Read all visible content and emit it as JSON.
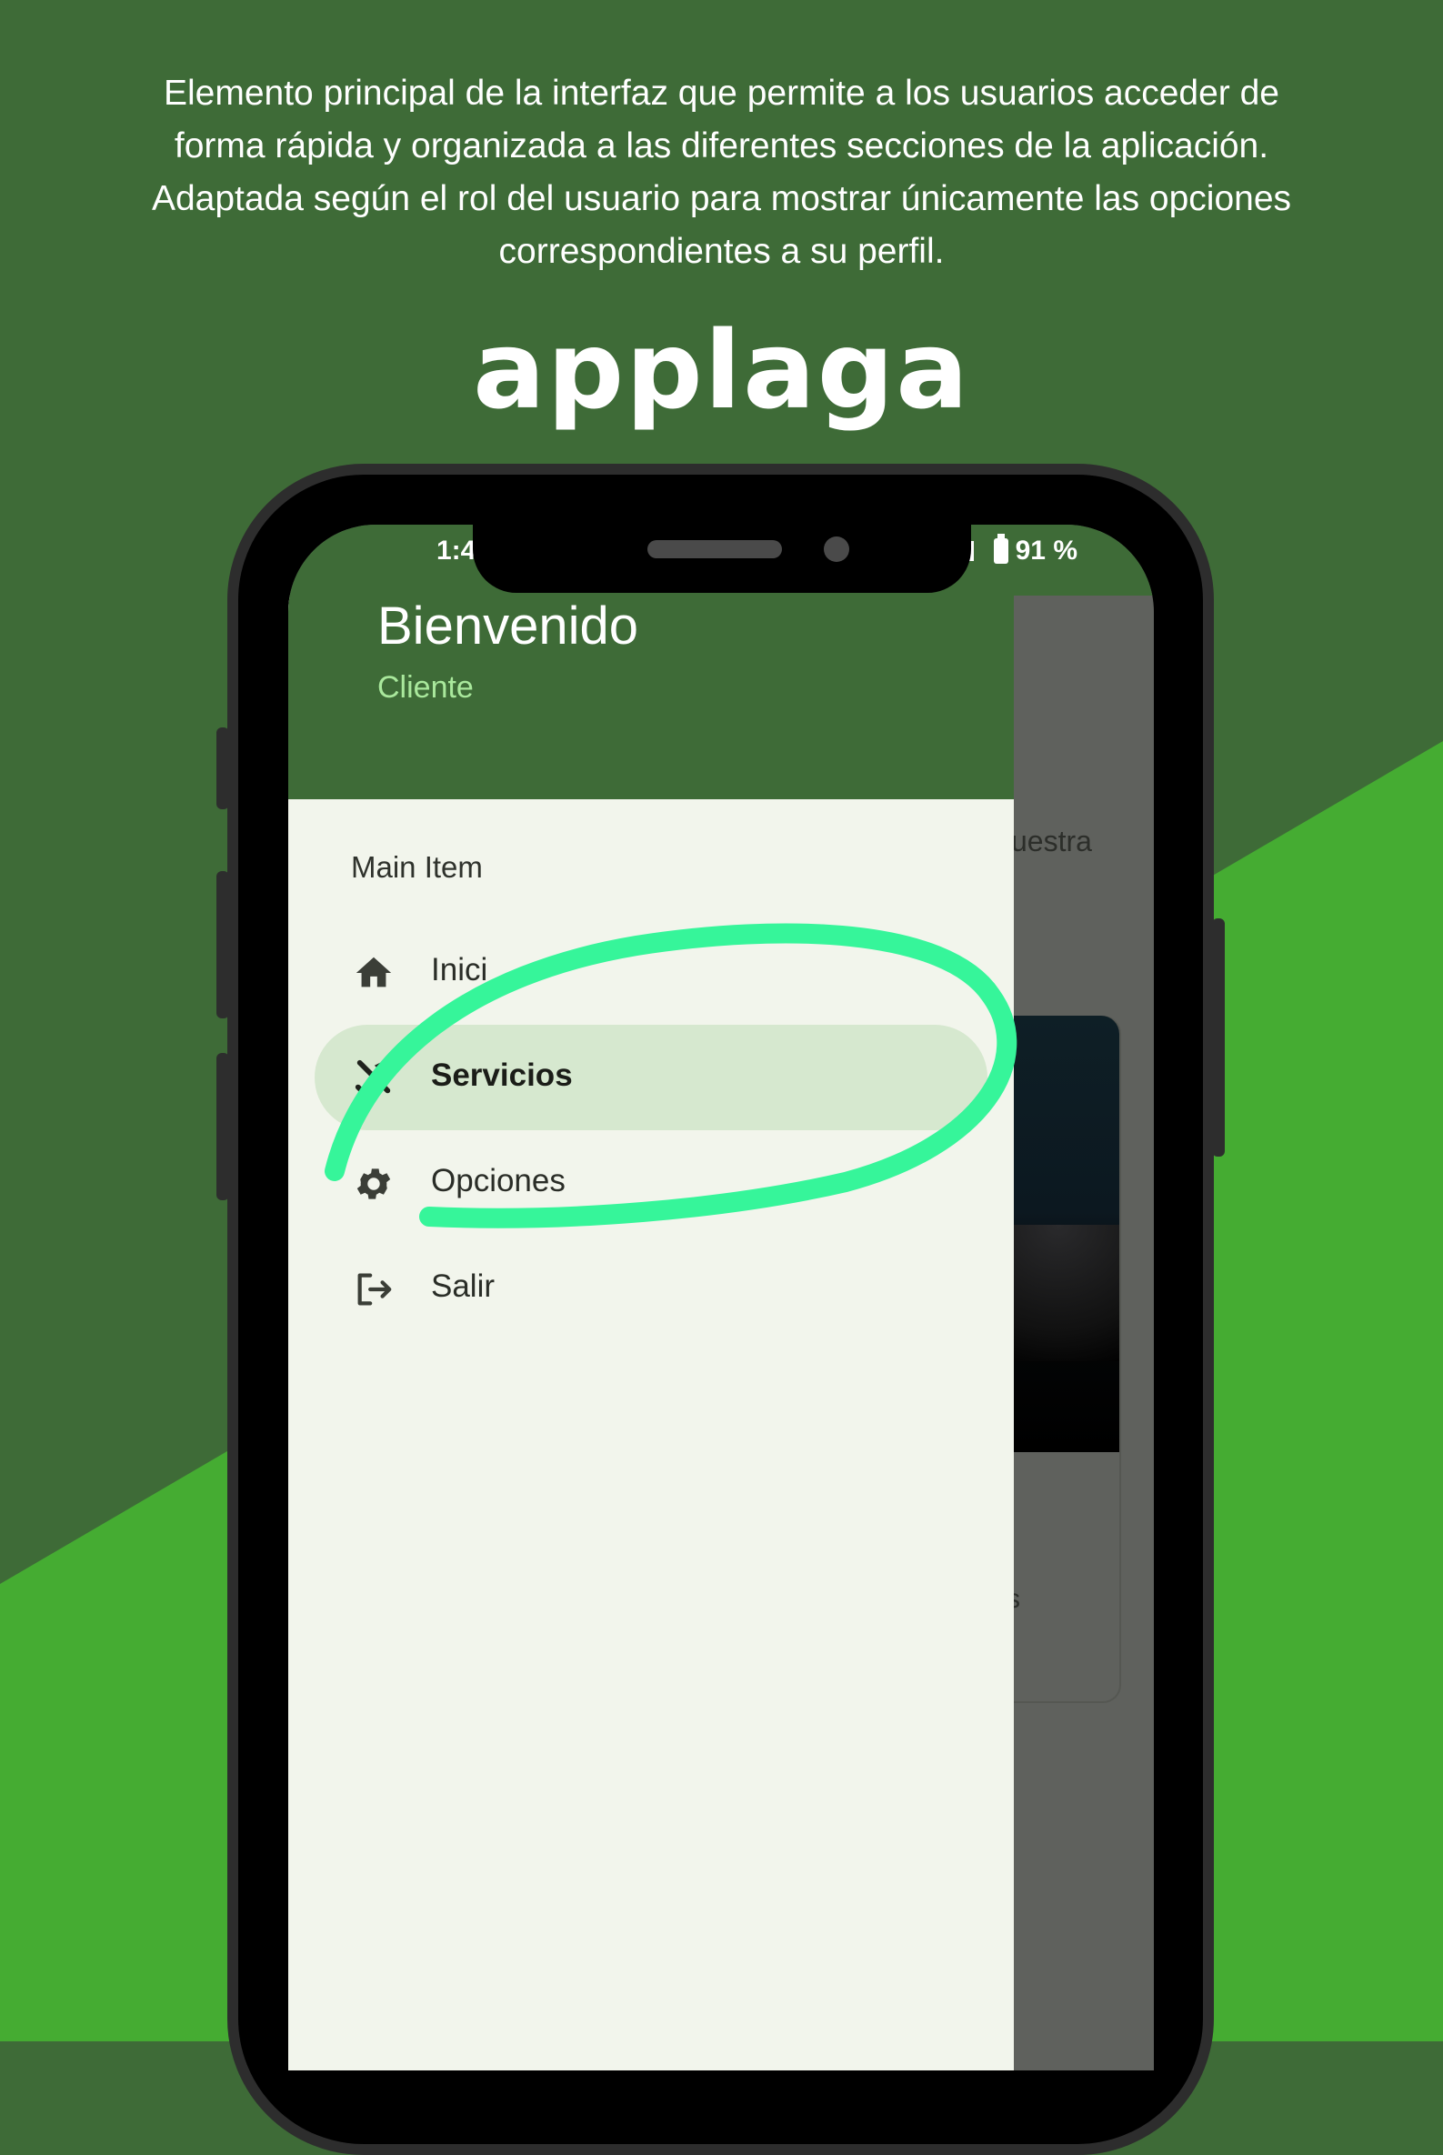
{
  "description": "Elemento principal de la interfaz que permite a los usuarios acceder de forma rápida y organizada a las diferentes secciones de la aplicación. Adaptada según el rol del usuario para mostrar únicamente las opciones correspondientes a su perfil.",
  "brand": "applaga",
  "colors": {
    "background_dark": "#3e6b37",
    "background_light": "#45ac32",
    "highlight_stroke": "#36f59a",
    "drawer_bg": "#f2f5ec",
    "active_item_bg": "#d6e8cf"
  },
  "statusbar": {
    "time": "1:4",
    "battery": "91 %"
  },
  "drawer": {
    "welcome": "Bienvenido",
    "role": "Cliente",
    "section_title": "Main Item",
    "items": [
      {
        "label": "Inici",
        "icon": "home-icon",
        "active": false
      },
      {
        "label": "Servicios",
        "icon": "tools-icon",
        "active": true
      },
      {
        "label": "Opciones",
        "icon": "gear-icon",
        "active": false
      },
      {
        "label": "Salir",
        "icon": "logout-icon",
        "active": false
      }
    ]
  },
  "background_app": {
    "text_fragment": "uestra",
    "card_fragment": "s"
  }
}
